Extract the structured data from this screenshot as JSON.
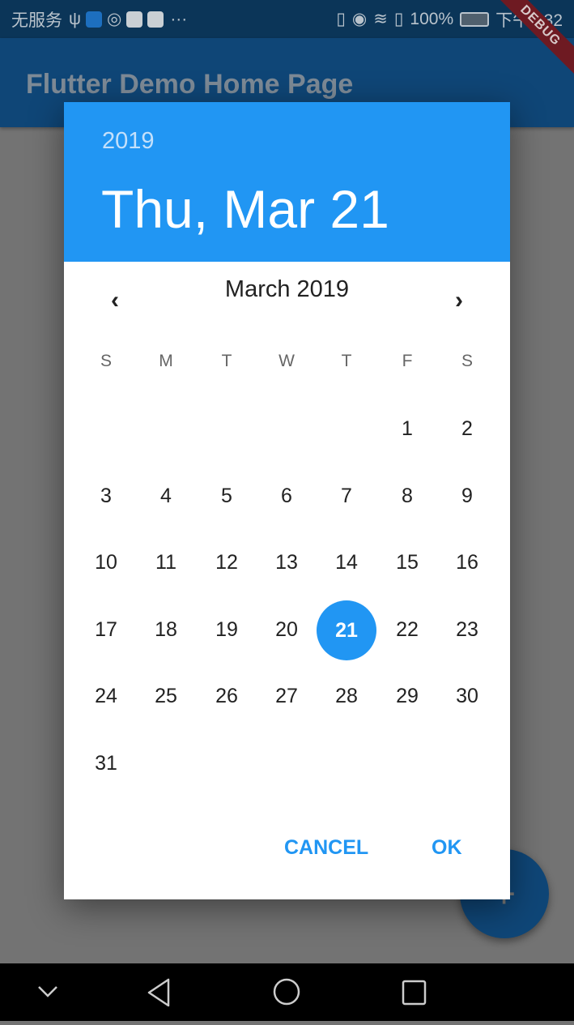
{
  "status_bar": {
    "carrier": "无服务",
    "battery": "100%",
    "time": "下午3:32"
  },
  "app_bar": {
    "title": "Flutter Demo Home Page",
    "debug_banner": "DEBUG"
  },
  "fab": {
    "icon": "plus-icon"
  },
  "date_picker": {
    "year": "2019",
    "selected_date": "Thu, Mar 21",
    "month_label": "March 2019",
    "weekdays": [
      "S",
      "M",
      "T",
      "W",
      "T",
      "F",
      "S"
    ],
    "weeks": [
      [
        null,
        null,
        null,
        null,
        null,
        "1",
        "2"
      ],
      [
        "3",
        "4",
        "5",
        "6",
        "7",
        "8",
        "9"
      ],
      [
        "10",
        "11",
        "12",
        "13",
        "14",
        "15",
        "16"
      ],
      [
        "17",
        "18",
        "19",
        "20",
        "21",
        "22",
        "23"
      ],
      [
        "24",
        "25",
        "26",
        "27",
        "28",
        "29",
        "30"
      ],
      [
        "31",
        null,
        null,
        null,
        null,
        null,
        null
      ]
    ],
    "selected_day": "21",
    "cancel_label": "CANCEL",
    "ok_label": "OK",
    "accent_color": "#2196f3"
  },
  "nav_bar": {
    "icons": [
      "chevron-down-icon",
      "back-icon",
      "home-icon",
      "recents-icon"
    ]
  }
}
